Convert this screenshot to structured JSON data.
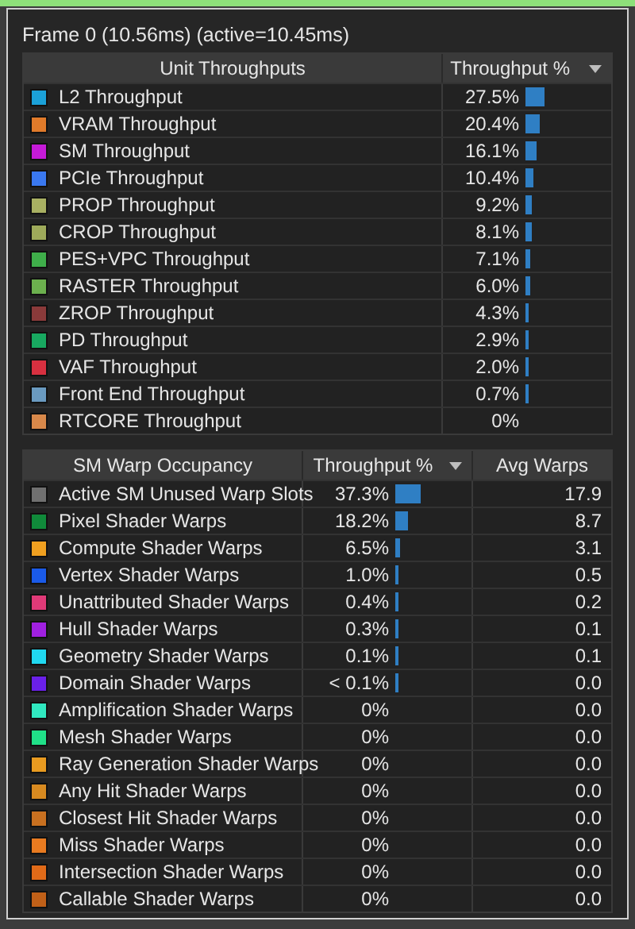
{
  "title": "Frame 0 (10.56ms) (active=10.45ms)",
  "unit_table": {
    "columns": [
      "Unit Throughputs",
      "Throughput %"
    ],
    "rows": [
      {
        "name": "L2 Throughput",
        "color": "#1ba1d8",
        "value": "27.5%"
      },
      {
        "name": "VRAM Throughput",
        "color": "#e07a2a",
        "value": "20.4%"
      },
      {
        "name": "SM Throughput",
        "color": "#c61ad8",
        "value": "16.1%"
      },
      {
        "name": "PCIe Throughput",
        "color": "#3a78f0",
        "value": "10.4%"
      },
      {
        "name": "PROP Throughput",
        "color": "#a8b062",
        "value": "9.2%"
      },
      {
        "name": "CROP Throughput",
        "color": "#9eaa5a",
        "value": "8.1%"
      },
      {
        "name": "PES+VPC Throughput",
        "color": "#3fae4a",
        "value": "7.1%"
      },
      {
        "name": "RASTER Throughput",
        "color": "#6cb04e",
        "value": "6.0%"
      },
      {
        "name": "ZROP Throughput",
        "color": "#8a3a3a",
        "value": "4.3%"
      },
      {
        "name": "PD Throughput",
        "color": "#18a860",
        "value": "2.9%"
      },
      {
        "name": "VAF Throughput",
        "color": "#d83040",
        "value": "2.0%"
      },
      {
        "name": "Front End Throughput",
        "color": "#6a9ac0",
        "value": "0.7%"
      },
      {
        "name": "RTCORE Throughput",
        "color": "#d8884a",
        "value": "0%"
      }
    ]
  },
  "warp_table": {
    "columns": [
      "SM Warp Occupancy",
      "Throughput %",
      "Avg Warps"
    ],
    "rows": [
      {
        "name": "Active SM Unused Warp Slots",
        "color": "#707070",
        "value": "37.3%",
        "avg": "17.9"
      },
      {
        "name": "Pixel Shader Warps",
        "color": "#108a3a",
        "value": "18.2%",
        "avg": "8.7"
      },
      {
        "name": "Compute Shader Warps",
        "color": "#f0a020",
        "value": "6.5%",
        "avg": "3.1"
      },
      {
        "name": "Vertex Shader Warps",
        "color": "#1a5ae8",
        "value": "1.0%",
        "avg": "0.5"
      },
      {
        "name": "Unattributed Shader Warps",
        "color": "#e03a78",
        "value": "0.4%",
        "avg": "0.2"
      },
      {
        "name": "Hull Shader Warps",
        "color": "#a020e0",
        "value": "0.3%",
        "avg": "0.1"
      },
      {
        "name": "Geometry Shader Warps",
        "color": "#20d8f0",
        "value": "0.1%",
        "avg": "0.1"
      },
      {
        "name": "Domain Shader Warps",
        "color": "#6a20e8",
        "value": "< 0.1%",
        "avg": "0.0"
      },
      {
        "name": "Amplification Shader Warps",
        "color": "#30e8c0",
        "value": "0%",
        "avg": "0.0"
      },
      {
        "name": "Mesh Shader Warps",
        "color": "#20e088",
        "value": "0%",
        "avg": "0.0"
      },
      {
        "name": "Ray Generation Shader Warps",
        "color": "#e89a20",
        "value": "0%",
        "avg": "0.0"
      },
      {
        "name": "Any Hit Shader Warps",
        "color": "#d88a20",
        "value": "0%",
        "avg": "0.0"
      },
      {
        "name": "Closest Hit Shader Warps",
        "color": "#c87020",
        "value": "0%",
        "avg": "0.0"
      },
      {
        "name": "Miss Shader Warps",
        "color": "#e87a20",
        "value": "0%",
        "avg": "0.0"
      },
      {
        "name": "Intersection Shader Warps",
        "color": "#e06a18",
        "value": "0%",
        "avg": "0.0"
      },
      {
        "name": "Callable Shader Warps",
        "color": "#c06018",
        "value": "0%",
        "avg": "0.0"
      }
    ]
  }
}
